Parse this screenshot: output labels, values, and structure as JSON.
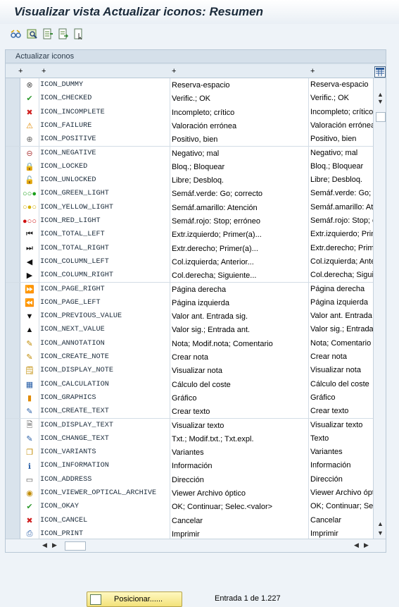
{
  "window": {
    "title": "Visualizar vista Actualizar iconos: Resumen"
  },
  "toolbar": {
    "buttons": [
      "glasses-icon",
      "find-icon",
      "export-icon",
      "import-icon",
      "select-icon"
    ]
  },
  "panel": {
    "title": "Actualizar iconos"
  },
  "table": {
    "headers": [
      "+",
      "+",
      "+",
      "+"
    ],
    "rows": [
      {
        "icon": "dummy-icon",
        "glyph": "⊗",
        "color": "#555",
        "name": "ICON_DUMMY",
        "short": "Reserva-espacio",
        "long": "Reserva-espacio"
      },
      {
        "icon": "checked-icon",
        "glyph": "✔",
        "color": "#2e9a2e",
        "name": "ICON_CHECKED",
        "short": "Verific.; OK",
        "long": "Verific.; OK"
      },
      {
        "icon": "incomplete-icon",
        "glyph": "✖",
        "color": "#d02020",
        "name": "ICON_INCOMPLETE",
        "short": "Incompleto; crítico",
        "long": "Incompleto; crítico"
      },
      {
        "icon": "failure-icon",
        "glyph": "⚠",
        "color": "#e08a00",
        "name": "ICON_FAILURE",
        "short": "Valoración errónea",
        "long": "Valoración errónea"
      },
      {
        "icon": "positive-icon",
        "glyph": "⊕",
        "color": "#666",
        "name": "ICON_POSITIVE",
        "short": "Positivo, bien",
        "long": "Positivo, bien"
      },
      {
        "icon": "negative-icon",
        "glyph": "⊖",
        "color": "#b04040",
        "name": "ICON_NEGATIVE",
        "short": "Negativo; mal",
        "long": "Negativo; mal"
      },
      {
        "icon": "lock-icon",
        "glyph": "🔒",
        "color": "#2a60a8",
        "name": "ICON_LOCKED",
        "short": "Bloq.; Bloquear",
        "long": "Bloq.; Bloquear"
      },
      {
        "icon": "unlock-icon",
        "glyph": "🔓",
        "color": "#2a60a8",
        "name": "ICON_UNLOCKED",
        "short": "Libre; Desbloq.",
        "long": "Libre; Desbloq."
      },
      {
        "icon": "green-light-icon",
        "glyph": "○○●",
        "color": "#1aa01a",
        "name": "ICON_GREEN_LIGHT",
        "short": "Semáf.verde: Go; correcto",
        "long": "Semáf.verde: Go; correcto"
      },
      {
        "icon": "yellow-light-icon",
        "glyph": "○●○",
        "color": "#d4b000",
        "name": "ICON_YELLOW_LIGHT",
        "short": "Semáf.amarillo: Atención",
        "long": "Semáf.amarillo: Atención"
      },
      {
        "icon": "red-light-icon",
        "glyph": "●○○",
        "color": "#d01010",
        "name": "ICON_RED_LIGHT",
        "short": "Semáf.rojo: Stop; erróneo",
        "long": "Semáf.rojo: Stop; erróneo"
      },
      {
        "icon": "total-left-icon",
        "glyph": "⏮",
        "color": "#111",
        "name": "ICON_TOTAL_LEFT",
        "short": "Extr.izquierdo; Primer(a)...",
        "long": "Extr.izquierdo; Primer(a)..."
      },
      {
        "icon": "total-right-icon",
        "glyph": "⏭",
        "color": "#111",
        "name": "ICON_TOTAL_RIGHT",
        "short": "Extr.derecho; Primer(a)...",
        "long": "Extr.derecho; Primer(a)..."
      },
      {
        "icon": "column-left-icon",
        "glyph": "◀",
        "color": "#111",
        "name": "ICON_COLUMN_LEFT",
        "short": "Col.izquierda; Anterior...",
        "long": "Col.izquierda; Anterior..."
      },
      {
        "icon": "column-right-icon",
        "glyph": "▶",
        "color": "#111",
        "name": "ICON_COLUMN_RIGHT",
        "short": "Col.derecha; Siguiente...",
        "long": "Col.derecha; Siguiente..."
      },
      {
        "icon": "page-right-icon",
        "glyph": "⏩",
        "color": "#111",
        "name": "ICON_PAGE_RIGHT",
        "short": "Página derecha",
        "long": "Página derecha"
      },
      {
        "icon": "page-left-icon",
        "glyph": "⏪",
        "color": "#111",
        "name": "ICON_PAGE_LEFT",
        "short": "Página izquierda",
        "long": "Página izquierda"
      },
      {
        "icon": "previous-value-icon",
        "glyph": "▼",
        "color": "#111",
        "name": "ICON_PREVIOUS_VALUE",
        "short": "Valor ant. Entrada sig.",
        "long": "Valor ant. Entrada sig."
      },
      {
        "icon": "next-value-icon",
        "glyph": "▲",
        "color": "#111",
        "name": "ICON_NEXT_VALUE",
        "short": "Valor sig.; Entrada ant.",
        "long": "Valor sig.; Entrada ant."
      },
      {
        "icon": "annotation-icon",
        "glyph": "✎",
        "color": "#c08a00",
        "name": "ICON_ANNOTATION",
        "short": "Nota; Modif.nota; Comentario",
        "long": "Nota; Comentario"
      },
      {
        "icon": "create-note-icon",
        "glyph": "✎",
        "color": "#c08a00",
        "name": "ICON_CREATE_NOTE",
        "short": "Crear nota",
        "long": "Crear nota"
      },
      {
        "icon": "display-note-icon",
        "glyph": "🗒",
        "color": "#c08a00",
        "name": "ICON_DISPLAY_NOTE",
        "short": "Visualizar nota",
        "long": "Visualizar nota"
      },
      {
        "icon": "calculation-icon",
        "glyph": "▦",
        "color": "#2a60a8",
        "name": "ICON_CALCULATION",
        "short": "Cálculo del coste",
        "long": "Cálculo del coste"
      },
      {
        "icon": "graphics-icon",
        "glyph": "▮",
        "color": "#e08a00",
        "name": "ICON_GRAPHICS",
        "short": "Gráfico",
        "long": "Gráfico"
      },
      {
        "icon": "create-text-icon",
        "glyph": "✎",
        "color": "#2a60a8",
        "name": "ICON_CREATE_TEXT",
        "short": "Crear texto",
        "long": "Crear texto"
      },
      {
        "icon": "display-text-icon",
        "glyph": "🗎",
        "color": "#555",
        "name": "ICON_DISPLAY_TEXT",
        "short": "Visualizar texto",
        "long": "Visualizar texto"
      },
      {
        "icon": "change-text-icon",
        "glyph": "✎",
        "color": "#2a60a8",
        "name": "ICON_CHANGE_TEXT",
        "short": "Txt.; Modif.txt.; Txt.expl.",
        "long": "Texto"
      },
      {
        "icon": "variants-icon",
        "glyph": "❐",
        "color": "#c08a00",
        "name": "ICON_VARIANTS",
        "short": "Variantes",
        "long": "Variantes"
      },
      {
        "icon": "information-icon",
        "glyph": "ℹ",
        "color": "#2a60a8",
        "name": "ICON_INFORMATION",
        "short": "Información",
        "long": "Información"
      },
      {
        "icon": "address-icon",
        "glyph": "▭",
        "color": "#555",
        "name": "ICON_ADDRESS",
        "short": "Dirección",
        "long": "Dirección"
      },
      {
        "icon": "viewer-optical-archive-icon",
        "glyph": "◉",
        "color": "#c08a00",
        "name": "ICON_VIEWER_OPTICAL_ARCHIVE",
        "short": "Viewer Archivo óptico",
        "long": "Viewer Archivo óptico"
      },
      {
        "icon": "okay-icon",
        "glyph": "✔",
        "color": "#2e9a2e",
        "name": "ICON_OKAY",
        "short": "OK; Continuar; Selec.<valor>",
        "long": "OK; Continuar; Selec.<valor>"
      },
      {
        "icon": "cancel-icon",
        "glyph": "✖",
        "color": "#d02020",
        "name": "ICON_CANCEL",
        "short": "Cancelar",
        "long": "Cancelar"
      },
      {
        "icon": "print-icon",
        "glyph": "⎙",
        "color": "#2a60a8",
        "name": "ICON_PRINT",
        "short": "Imprimir",
        "long": "Imprimir"
      }
    ]
  },
  "footer": {
    "position_button": "Posicionar......",
    "entry_info": "Entrada 1 de 1.227"
  }
}
